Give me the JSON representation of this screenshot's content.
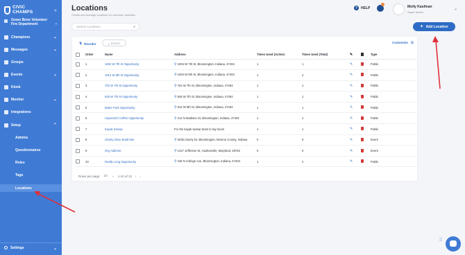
{
  "brand": {
    "line1": "CIVIC",
    "line2": "CHAMPS"
  },
  "sidebar": {
    "org_name_line1": "Grave Bone Volunteer",
    "org_name_line2": "Fire Department",
    "items": [
      {
        "label": "Champions",
        "icon": "users-icon",
        "chevron": true
      },
      {
        "label": "Messages",
        "icon": "message-icon",
        "chevron": true
      },
      {
        "label": "Groups",
        "icon": "groups-icon",
        "chevron": false
      },
      {
        "label": "Events",
        "icon": "calendar-icon",
        "chevron": true
      },
      {
        "label": "Kiosk",
        "icon": "kiosk-icon",
        "chevron": false
      },
      {
        "label": "Monitor",
        "icon": "monitor-icon",
        "chevron": true
      },
      {
        "label": "Integrations",
        "icon": "integrations-icon",
        "chevron": false
      },
      {
        "label": "Setup",
        "icon": "setup-icon",
        "chevron": true
      }
    ],
    "sub_items": [
      "Admins",
      "Questionnaires",
      "Roles",
      "Tags",
      "Locations"
    ],
    "active_sub": "Locations",
    "bottom": "Settings"
  },
  "header": {
    "title": "Locations",
    "subtitle": "Create and manage locations for volunteer activities",
    "help": "HELP",
    "user_name": "Molly Kaufman",
    "user_role": "Super Admin"
  },
  "search": {
    "placeholder": "Search Locations"
  },
  "add_button": "Add Location",
  "toolbar": {
    "reorder": "Reorder",
    "export": "Export",
    "customize": "Customize"
  },
  "table": {
    "columns": [
      "Order",
      "Name",
      "Address",
      "Times Used (Active)",
      "Times Used (Total)",
      "Type"
    ],
    "rows": [
      {
        "order": "1",
        "name": "1004 W 7th St Opportunity",
        "address": "1004 W 7th St, Bloomington, Indiana, 47404",
        "pin": true,
        "active": "1",
        "total": "1",
        "type": "Public"
      },
      {
        "order": "2",
        "name": "1012 W 8th St Opportunity",
        "address": "1004 W 8th St, Bloomington, Indiana, 47404",
        "pin": true,
        "active": "1",
        "total": "4",
        "type": "Public"
      },
      {
        "order": "3",
        "name": "702 W 7th St Opportunity",
        "address": "702 W 7th St, Bloomington, Indiana, 47404",
        "pin": true,
        "active": "1",
        "total": "1",
        "type": "Public"
      },
      {
        "order": "4",
        "name": "826 W 7th St Opportunity",
        "address": "826 W 7th St, Bloomington, Indiana, 47404",
        "pin": true,
        "active": "1",
        "total": "1",
        "type": "Public"
      },
      {
        "order": "5",
        "name": "Butler Park Opportunity",
        "address": "812 W 9th St, Bloomington, Indiana, 47404",
        "pin": true,
        "active": "1",
        "total": "1",
        "type": "Public"
      },
      {
        "order": "6",
        "name": "Hopscotch Coffee Opportunity",
        "address": "212 N Madison St, Bloomington, Indiana, 47404",
        "pin": true,
        "active": "1",
        "total": "1",
        "type": "Public"
      },
      {
        "order": "7",
        "name": "Kayak Sweep",
        "address": "For the kayak sweep team to log hours",
        "pin": false,
        "active": "1",
        "total": "1",
        "type": "Public"
      },
      {
        "order": "8",
        "name": "Liberty Drive Build Site",
        "address": "2035 Liberty Dr, Bloomington, Monroe County, Indiana",
        "pin": true,
        "active": "0",
        "total": "0",
        "type": "Event"
      },
      {
        "order": "9",
        "name": "Org Address",
        "address": "1417 Jefferson St, Hudsonville, Maryland, 26782",
        "pin": true,
        "active": "0",
        "total": "0",
        "type": "Event"
      },
      {
        "order": "10",
        "name": "Really Long Opportunity",
        "address": "245 N College Ave, Bloomington, Indiana, 47404",
        "pin": true,
        "active": "1",
        "total": "2",
        "type": "Public"
      }
    ]
  },
  "pager": {
    "rows_label": "Rows per page:",
    "rows_value": "10",
    "range": "1-10 of 10"
  },
  "colors": {
    "sidebar": "#3f7bd5",
    "accent": "#2d6bc4",
    "arrow": "#e0303a"
  }
}
